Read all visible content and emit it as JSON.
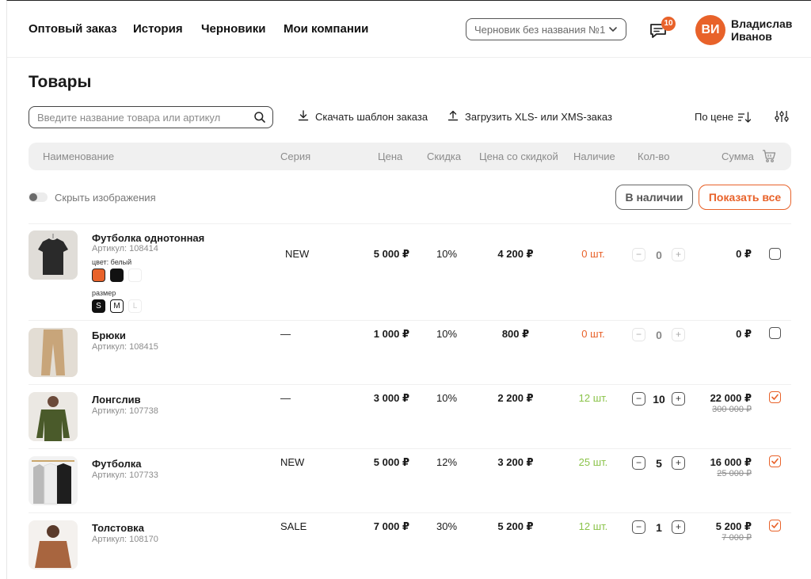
{
  "nav": {
    "items": [
      {
        "label": "Оптовый заказ"
      },
      {
        "label": "История"
      },
      {
        "label": "Черновики"
      },
      {
        "label": "Мои компании"
      }
    ]
  },
  "draft_select": {
    "value": "Черновик без названия №1"
  },
  "notifications": {
    "count": "10"
  },
  "user": {
    "initials": "ВИ",
    "name": "Владислав Иванов"
  },
  "page": {
    "title": "Товары"
  },
  "toolbar": {
    "search_placeholder": "Введите название товара или артикул",
    "download_label": "Скачать шаблон заказа",
    "upload_label": "Загрузить XLS- или XMS-заказ",
    "sort_label": "По цене"
  },
  "table": {
    "headers": {
      "name": "Наименование",
      "series": "Серия",
      "price": "Цена",
      "discount": "Скидка",
      "discount_price": "Цена со скидкой",
      "stock": "Наличие",
      "qty": "Кол-во",
      "sum": "Сумма"
    }
  },
  "filters": {
    "hide_images_label": "Скрыть изображения",
    "in_stock_label": "В наличии",
    "show_all_label": "Показать все"
  },
  "accent_color": "#e8622a",
  "products": [
    {
      "name": "Футболка однотонная",
      "sku": "Артикул: 108414",
      "series": "NEW",
      "price": "5 000 ₽",
      "discount": "10%",
      "discount_price": "4 200 ₽",
      "stock": "0 шт.",
      "qty": "0",
      "sum": "0 ₽",
      "old_sum": "",
      "checked": false,
      "color_label": "цвет: белый",
      "size_label": "размер",
      "sizes": [
        "S",
        "M",
        "L"
      ]
    },
    {
      "name": "Брюки",
      "sku": "Артикул: 108415",
      "series": "—",
      "price": "1 000 ₽",
      "discount": "10%",
      "discount_price": "800 ₽",
      "stock": "0 шт.",
      "qty": "0",
      "sum": "0 ₽",
      "old_sum": "",
      "checked": false
    },
    {
      "name": "Лонгслив",
      "sku": "Артикул: 107738",
      "series": "—",
      "price": "3 000 ₽",
      "discount": "10%",
      "discount_price": "2 200 ₽",
      "stock": "12 шт.",
      "qty": "10",
      "sum": "22 000 ₽",
      "old_sum": "300 000 ₽",
      "checked": true
    },
    {
      "name": "Футболка",
      "sku": "Артикул: 107733",
      "series": "NEW",
      "price": "5 000 ₽",
      "discount": "12%",
      "discount_price": "3 200 ₽",
      "stock": "25 шт.",
      "qty": "5",
      "sum": "16 000 ₽",
      "old_sum": "25 000 ₽",
      "checked": true
    },
    {
      "name": "Толстовка",
      "sku": "Артикул: 108170",
      "series": "SALE",
      "price": "7 000 ₽",
      "discount": "30%",
      "discount_price": "5 200 ₽",
      "stock": "12 шт.",
      "qty": "1",
      "sum": "5 200 ₽",
      "old_sum": "7 000 ₽",
      "checked": true
    }
  ]
}
